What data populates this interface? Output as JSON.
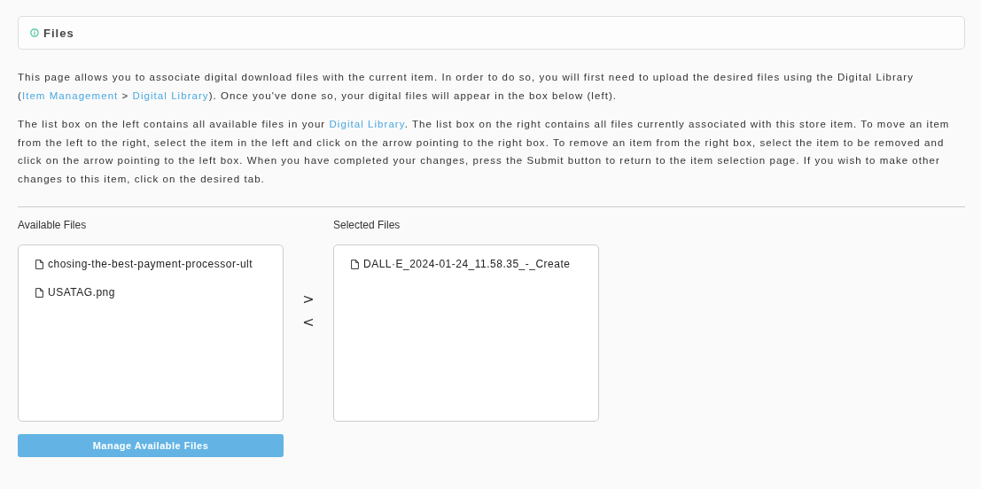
{
  "panel": {
    "title": "Files"
  },
  "paragraphs": [
    [
      {
        "kind": "text",
        "text": "This page allows you to associate digital download files with the current item. In order to do so, you will first need to upload the desired files using the Digital Library ("
      },
      {
        "kind": "link",
        "text": "Item Management"
      },
      {
        "kind": "text",
        "text": " > "
      },
      {
        "kind": "link",
        "text": "Digital Library"
      },
      {
        "kind": "text",
        "text": "). Once you've done so, your digital files will appear in the box below (left)."
      }
    ],
    [
      {
        "kind": "text",
        "text": "The list box on the left contains all available files in your "
      },
      {
        "kind": "link",
        "text": "Digital Library"
      },
      {
        "kind": "text",
        "text": ". The list box on the right contains all files currently associated with this store item. To move an item from the left to the right, select the item in the left and click on the arrow pointing to the right box. To remove an item from the right box, select the item to be removed and click on the arrow pointing to the left box. When you have completed your changes, press the Submit button to return to the item selection page. If you wish to make other changes to this item, click on the desired tab."
      }
    ]
  ],
  "available": {
    "label": "Available Files",
    "files": [
      "chosing-the-best-payment-processor-ult",
      "USATAG.png"
    ]
  },
  "move_buttons": [
    ">",
    "<"
  ],
  "selected": {
    "label": "Selected Files",
    "files": [
      "DALL·E_2024-01-24_11.58.35_-_Create"
    ]
  },
  "manage_button": "Manage Available Files"
}
